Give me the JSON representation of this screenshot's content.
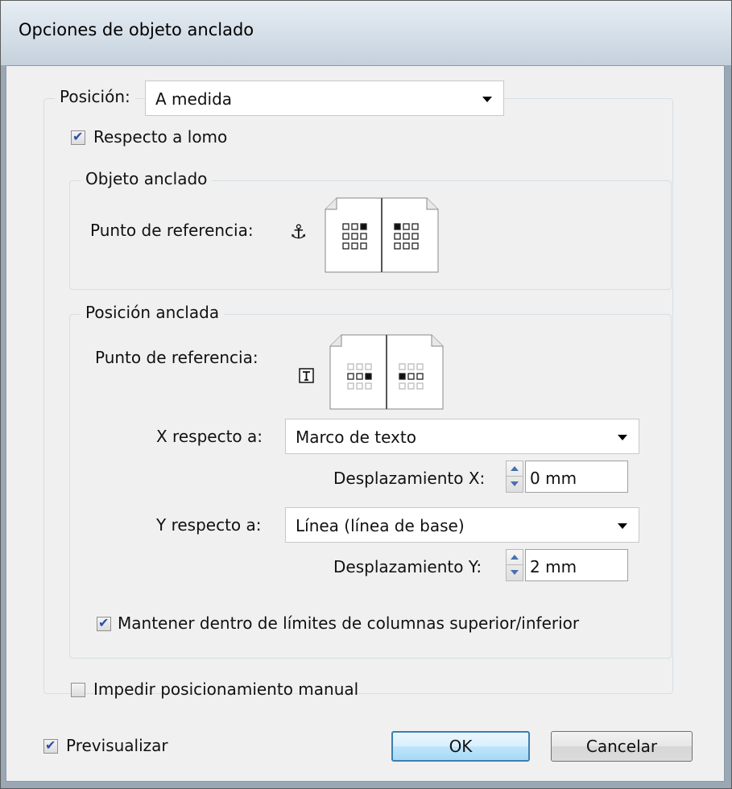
{
  "window": {
    "title": "Opciones de objeto anclado"
  },
  "position": {
    "label": "Posición:",
    "value": "A medida"
  },
  "relative_to_spine": {
    "label": "Respecto a lomo",
    "checked": true
  },
  "anchored_object": {
    "legend": "Objeto anclado",
    "ref_point_label": "Punto de referencia:"
  },
  "anchored_position": {
    "legend": "Posición anclada",
    "ref_point_label": "Punto de referencia:",
    "x_relative_label": "X respecto a:",
    "x_relative_value": "Marco de texto",
    "x_offset_label": "Desplazamiento X:",
    "x_offset_value": "0 mm",
    "y_relative_label": "Y respecto a:",
    "y_relative_value": "Línea (línea de base)",
    "y_offset_label": "Desplazamiento Y:",
    "y_offset_value": "2 mm",
    "keep_within_label": "Mantener dentro de límites de columnas superior/inferior",
    "keep_within_checked": true
  },
  "prevent_manual": {
    "label": "Impedir posicionamiento manual",
    "checked": false
  },
  "preview": {
    "label": "Previsualizar",
    "checked": true
  },
  "buttons": {
    "ok": "OK",
    "cancel": "Cancelar"
  },
  "icons": {
    "anchor": "anchor-icon",
    "text_frame": "text-frame-icon"
  }
}
